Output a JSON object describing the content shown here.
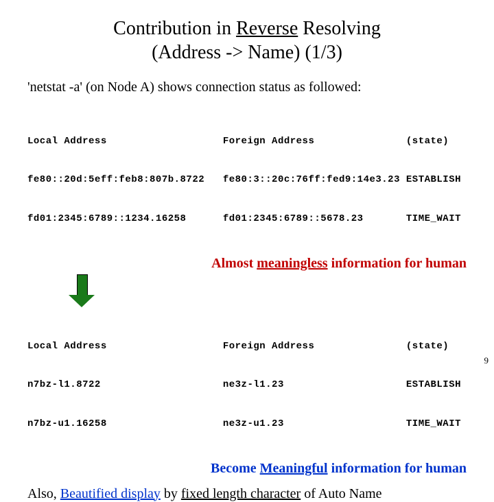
{
  "title": {
    "pre": "Contribution in ",
    "underlined": "Reverse",
    "post": " Resolving",
    "line2": "(Address -> Name)   (1/3)"
  },
  "intro": "'netstat -a' (on Node A) shows connection status as followed:",
  "table1": {
    "header": "Local Address                   Foreign Address               (state)",
    "row1": "fe80::20d:5eff:feb8:807b.8722   fe80:3::20c:76ff:fed9:14e3.23 ESTABLISH",
    "row2": "fd01:2345:6789::1234.16258      fd01:2345:6789::5678.23       TIME_WAIT"
  },
  "caption1": {
    "pre": "Almost ",
    "under": "meaningless",
    "post": " information for human"
  },
  "table2": {
    "header": "Local Address                   Foreign Address               (state)",
    "row1": "n7bz-l1.8722                    ne3z-l1.23                    ESTABLISH",
    "row2": "n7bz-u1.16258                   ne3z-u1.23                    TIME_WAIT"
  },
  "caption2": {
    "pre": "Become ",
    "under": "Meaningful",
    "post": " information for human"
  },
  "footer": {
    "p1": "Also, ",
    "blue": "Beautified display",
    "p2": " by ",
    "u2": "fixed length character",
    "p3": " of Auto Name"
  },
  "page": "9"
}
